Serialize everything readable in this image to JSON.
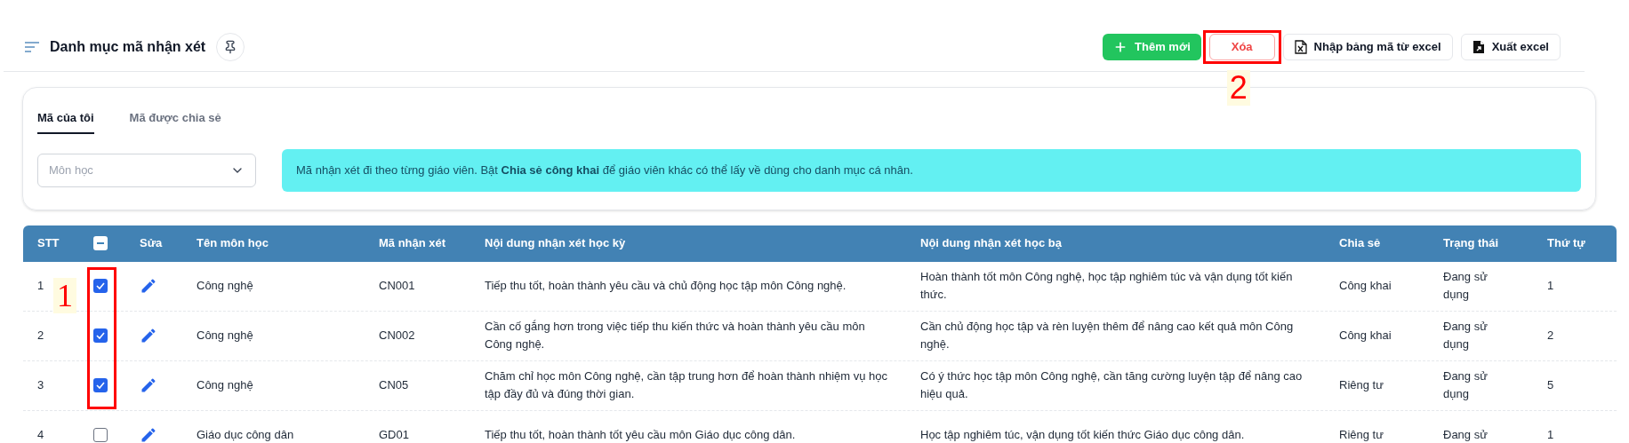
{
  "header": {
    "title": "Danh mục mã nhận xét",
    "buttons": [
      {
        "kind": "add",
        "label": "Thêm mới"
      },
      {
        "kind": "delete",
        "label": "Xóa"
      },
      {
        "kind": "import",
        "label": "Nhập bảng mã từ excel"
      },
      {
        "kind": "export",
        "label": "Xuất excel"
      }
    ]
  },
  "tabs": [
    {
      "label": "Mã của tôi",
      "selected": true
    },
    {
      "label": "Mã được chia sẻ",
      "selected": false
    }
  ],
  "filter": {
    "placeholder": "Môn học"
  },
  "notice": "Mã nhận xét đi theo từng giáo viên. Bật **Chia sẻ công khai** để giáo viên khác có thể lấy về dùng cho danh mục cá nhân.",
  "table": {
    "columns": [
      "STT",
      "Sửa",
      "Tên môn học",
      "Mã nhận xét",
      "Nội dung nhận xét học kỳ",
      "Nội dung nhận xét học bạ",
      "Chia sẻ",
      "Trạng thái",
      "Thứ tự"
    ],
    "select_all_partial": true,
    "rows": [
      {
        "stt": "1",
        "checked": true,
        "subject": "Công nghệ",
        "code": "CN001",
        "term_comment": "Tiếp thu tốt, hoàn thành yêu cầu và chủ động học tập môn Công nghệ.",
        "record_comment": "Hoàn thành tốt môn Công nghệ, học tập nghiêm túc và vận dụng tốt kiến thức.",
        "sharing": "Công khai",
        "status": "Đang sử dụng",
        "order": "1"
      },
      {
        "stt": "2",
        "checked": true,
        "subject": "Công nghệ",
        "code": "CN002",
        "term_comment": "Cần cố gắng hơn trong việc tiếp thu kiến thức và hoàn thành yêu cầu môn Công nghệ.",
        "record_comment": "Cần chủ động học tập và rèn luyện thêm để nâng cao kết quả môn Công nghệ.",
        "sharing": "Công khai",
        "status": "Đang sử dụng",
        "order": "2"
      },
      {
        "stt": "3",
        "checked": true,
        "subject": "Công nghệ",
        "code": "CN05",
        "term_comment": "Chăm chỉ học môn Công nghệ, cần tập trung hơn để hoàn thành nhiệm vụ học tập đầy đủ và đúng thời gian.",
        "record_comment": "Có ý thức học tập môn Công nghệ, cần tăng cường luyện tập để nâng cao hiệu quả.",
        "sharing": "Riêng tư",
        "status": "Đang sử dụng",
        "order": "5"
      },
      {
        "stt": "4",
        "checked": false,
        "subject": "Giáo dục công dân",
        "code": "GD01",
        "term_comment": "Tiếp thu tốt, hoàn thành tốt yêu cầu môn Giáo dục công dân.",
        "record_comment": "Học tập nghiêm túc, vận dụng tốt kiến thức Giáo dục công dân.",
        "sharing": "Riêng tư",
        "status": "Đang sử",
        "order": "1"
      }
    ]
  },
  "annotations": [
    {
      "label": "1",
      "kind": "column"
    },
    {
      "label": "2",
      "kind": "button"
    }
  ]
}
